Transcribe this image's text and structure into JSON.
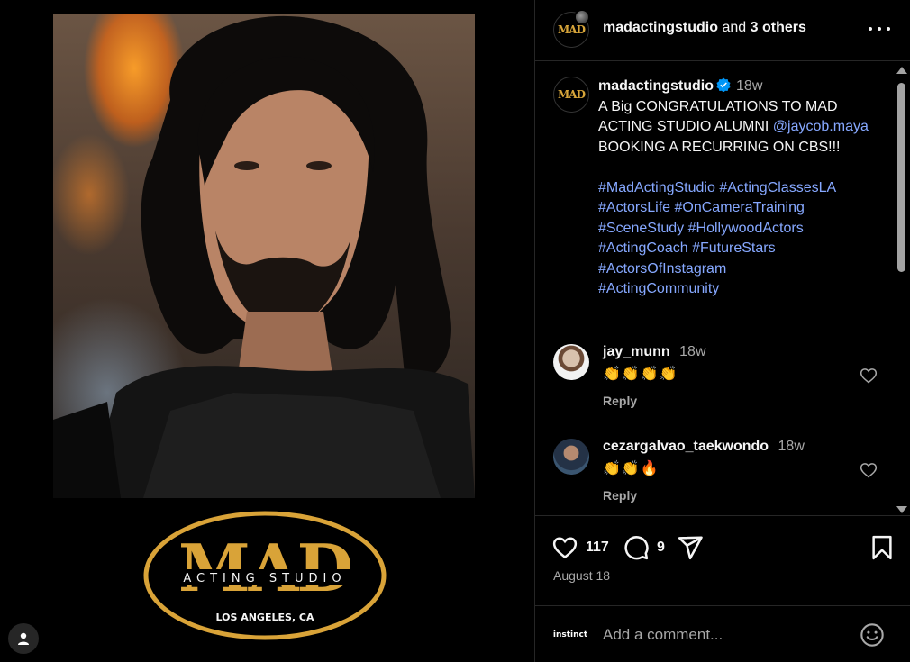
{
  "media": {
    "logo": {
      "big_text": "MAD",
      "sub_text": "ACTING STUDIO",
      "city_text": "LOS ANGELES, CA"
    }
  },
  "header": {
    "username": "madactingstudio",
    "and_text": "and",
    "others": "3 others"
  },
  "caption": {
    "username": "madactingstudio",
    "time": "18w",
    "line1": "A Big CONGRATULATIONS TO MAD ACTING STUDIO ALUMNI ",
    "mention": "@jaycob.maya",
    "line2": " BOOKING A RECURRING ON CBS!!!",
    "hashtags": [
      "#MadActingStudio",
      "#ActingClassesLA",
      "#ActorsLife",
      "#OnCameraTraining",
      "#SceneStudy",
      "#HollywoodActors",
      "#ActingCoach",
      "#FutureStars",
      "#ActorsOfInstagram",
      "#ActingCommunity"
    ]
  },
  "comments": [
    {
      "username": "jay_munn",
      "time": "18w",
      "text": "👏👏👏👏",
      "reply": "Reply"
    },
    {
      "username": "cezargalvao_taekwondo",
      "time": "18w",
      "text": "👏👏🔥",
      "reply": "Reply"
    }
  ],
  "actions": {
    "likes": "117",
    "comments": "9",
    "date": "August 18"
  },
  "add_comment": {
    "avatar_text": "instinct",
    "placeholder": "Add a comment..."
  },
  "colors": {
    "link": "#86a8ff",
    "verified": "#0095f6",
    "logo_gold": "#d9a338"
  }
}
